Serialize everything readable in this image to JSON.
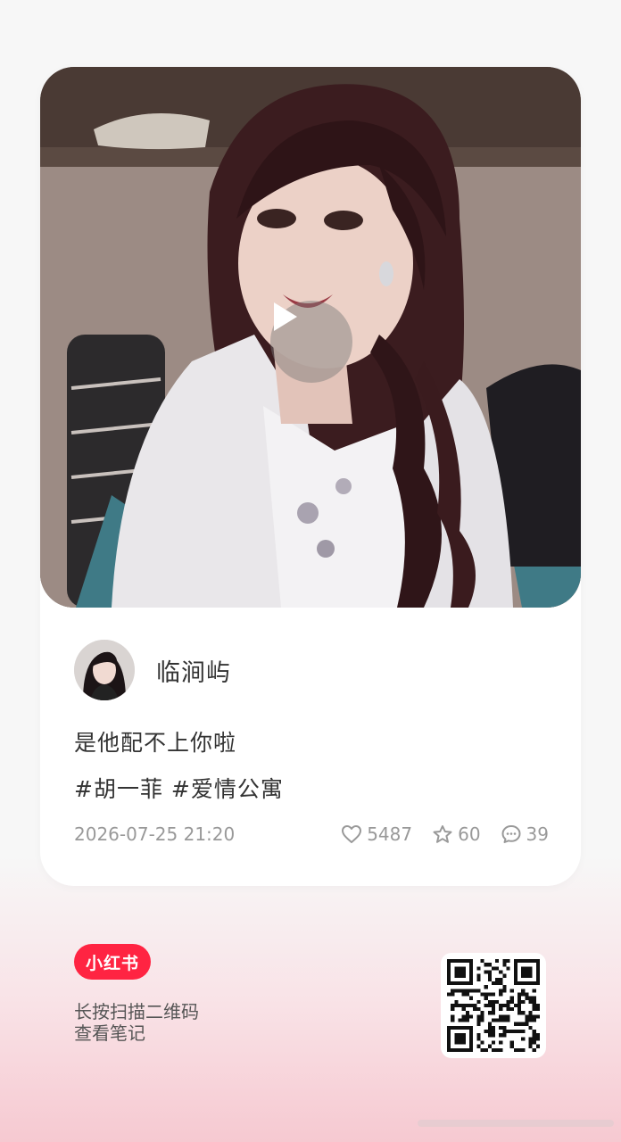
{
  "post": {
    "author_name": "临涧屿",
    "title": "是他配不上你啦",
    "tags": "#胡一菲 #爱情公寓",
    "date": "2026-07-25 21:20",
    "likes": "5487",
    "collects": "60",
    "comments": "39"
  },
  "footer": {
    "logo_text": "小红书",
    "hint_line1": "长按扫描二维码",
    "hint_line2": "查看笔记"
  },
  "icons": {
    "play": "play-icon",
    "like": "heart-icon",
    "collect": "star-icon",
    "comment": "comment-icon"
  },
  "colors": {
    "brand": "#ff2442",
    "text_primary": "#333333",
    "text_secondary": "#999999"
  }
}
